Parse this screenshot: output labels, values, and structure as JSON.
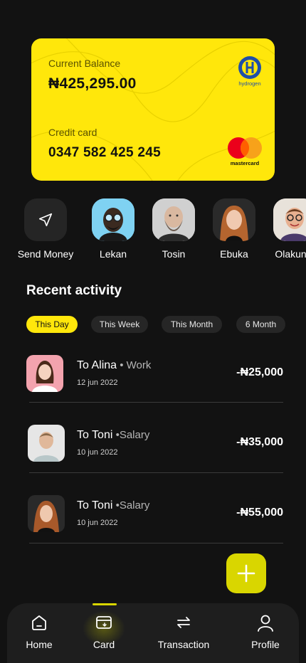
{
  "card": {
    "balance_label": "Current Balance",
    "balance": "₦425,295.00",
    "credit_label": "Credit card",
    "card_number": "0347 582 425 245",
    "bank_logo_text": "hydrogen",
    "network_text": "mastercard",
    "color": "#FFE70B"
  },
  "contacts": [
    {
      "name": "Send Money",
      "icon": "send-icon"
    },
    {
      "name": "Lekan",
      "bg": "#7fd2f2"
    },
    {
      "name": "Tosin",
      "bg": "#cfcfcf"
    },
    {
      "name": "Ebuka",
      "bg": "#2d2d2d"
    },
    {
      "name": "Olakunle",
      "bg": "#e8e2da"
    }
  ],
  "activity": {
    "title": "Recent activity",
    "filters": [
      "This Day",
      "This Week",
      "This Month",
      "6 Month"
    ],
    "active_filter": "This Day",
    "transactions": [
      {
        "title": "To Alina",
        "tag": " • Work",
        "date": "12 jun 2022",
        "amount": "-₦25,000"
      },
      {
        "title": "To Toni",
        "tag": " •Salary",
        "date": "10 jun 2022",
        "amount": "-₦35,000"
      },
      {
        "title": "To Toni",
        "tag": " •Salary",
        "date": "10 jun 2022",
        "amount": "-₦55,000"
      }
    ]
  },
  "nav": {
    "items": [
      {
        "label": "Home",
        "icon": "home-icon"
      },
      {
        "label": "Card",
        "icon": "card-icon"
      },
      {
        "label": "Transaction",
        "icon": "transfer-icon"
      },
      {
        "label": "Profile",
        "icon": "profile-icon"
      }
    ],
    "active": "Card",
    "accent": "#D9D600"
  }
}
